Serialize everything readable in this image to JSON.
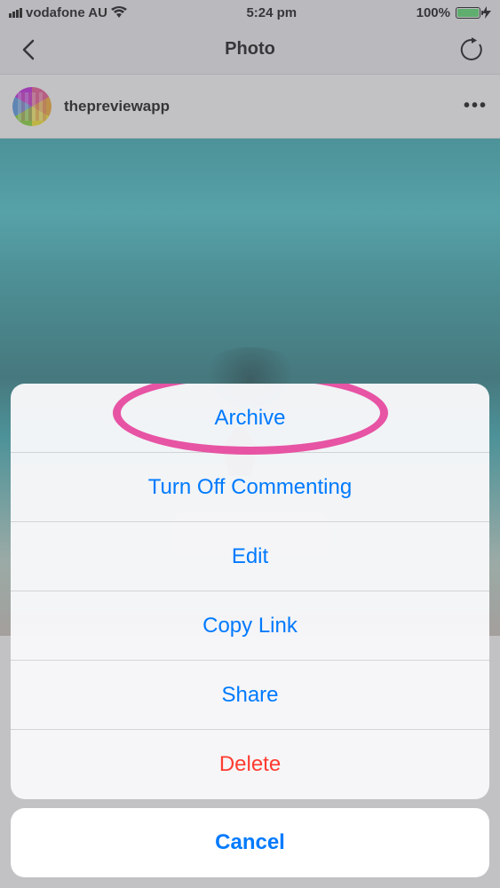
{
  "status": {
    "carrier": "vodafone AU",
    "time": "5:24 pm",
    "battery_pct": "100%"
  },
  "nav": {
    "title": "Photo"
  },
  "post": {
    "username": "thepreviewapp"
  },
  "sheet": {
    "items": [
      {
        "label": "Archive",
        "destructive": false
      },
      {
        "label": "Turn Off Commenting",
        "destructive": false
      },
      {
        "label": "Edit",
        "destructive": false
      },
      {
        "label": "Copy Link",
        "destructive": false
      },
      {
        "label": "Share",
        "destructive": false
      },
      {
        "label": "Delete",
        "destructive": true
      }
    ],
    "cancel_label": "Cancel"
  },
  "annotation": {
    "circled_index": 0
  }
}
